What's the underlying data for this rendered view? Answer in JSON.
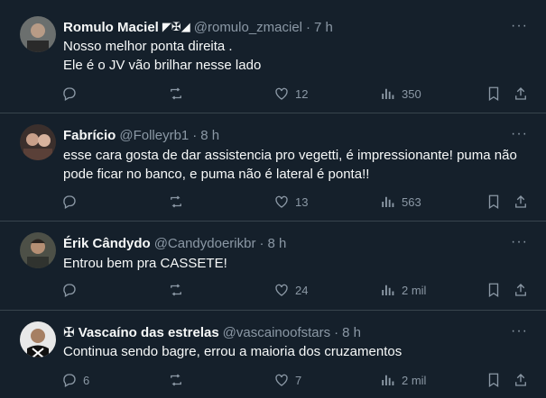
{
  "tweets": [
    {
      "name": "Romulo Maciel",
      "badge": "◤✠◢",
      "handle": "@romulo_zmaciel",
      "time": "7 h",
      "text": "Nosso melhor ponta direita .\nEle  é o JV vão brilhar nesse lado",
      "replies": "",
      "retweets": "",
      "likes": "12",
      "views": "350"
    },
    {
      "name": "Fabrício",
      "badge": "",
      "handle": "@Folleyrb1",
      "time": "8 h",
      "text": "esse cara gosta de dar assistencia pro vegetti, é impressionante! puma não pode ficar no banco, e puma não é lateral é ponta!!",
      "replies": "",
      "retweets": "",
      "likes": "13",
      "views": "563"
    },
    {
      "name": "Érik Cândydo",
      "badge": "",
      "handle": "@Candydoerikbr",
      "time": "8 h",
      "text": "Entrou bem pra CASSETE!",
      "replies": "",
      "retweets": "",
      "likes": "24",
      "views": "2 mil"
    },
    {
      "name": "✠ Vascaíno das estrelas",
      "badge": "",
      "handle": "@vascainoofstars",
      "time": "8 h",
      "text": "Continua sendo bagre, errou a maioria dos cruzamentos",
      "replies": "6",
      "retweets": "",
      "likes": "7",
      "views": "2 mil"
    }
  ],
  "dot": "·",
  "more": "···",
  "icons": [
    "reply-icon",
    "retweet-icon",
    "like-icon",
    "views-icon",
    "bookmark-icon",
    "share-icon"
  ]
}
